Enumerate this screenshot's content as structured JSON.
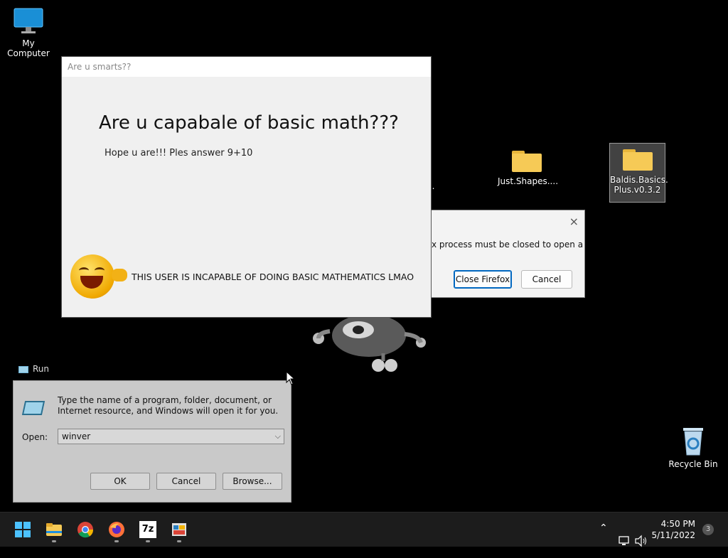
{
  "desktop": {
    "icons": {
      "my_computer": "My Computer",
      "partial_left": "...",
      "just_shapes": "Just.Shapes....",
      "baldis_line1": "Baldis.Basics.",
      "baldis_line2": "Plus.v0.3.2",
      "recycle_bin": "Recycle Bin"
    }
  },
  "math_dialog": {
    "title": "Are u smarts??",
    "heading": "Are u capabale of basic math???",
    "prompt": "Hope u are!!! Ples answer 9+10",
    "verdict": "THIS USER IS INCAPABLE OF DOING BASIC MATHEMATICS LMAO"
  },
  "firefox_dialog": {
    "message": "x process must be closed to open a",
    "close_button": "Close Firefox",
    "cancel_button": "Cancel",
    "close_icon": "×"
  },
  "run_dialog": {
    "title": "Run",
    "description": "Type the name of a program, folder, document, or Internet resource, and Windows will open it for you.",
    "open_label": "Open:",
    "input_value": "winver",
    "ok_button": "OK",
    "cancel_button": "Cancel",
    "browse_button": "Browse..."
  },
  "taskbar": {
    "apps": [
      "start-icon",
      "file-explorer-icon",
      "chrome-icon",
      "firefox-icon",
      "7zip-icon",
      "control-panel-icon"
    ],
    "sevenzip_label": "7z",
    "time": "4:50 PM",
    "date": "5/11/2022",
    "notification_count": "3"
  },
  "colors": {
    "desktop_bg": "#000000",
    "taskbar_bg": "#1c1c1c",
    "accent": "#0067c0",
    "folder": "#f6ca56"
  }
}
